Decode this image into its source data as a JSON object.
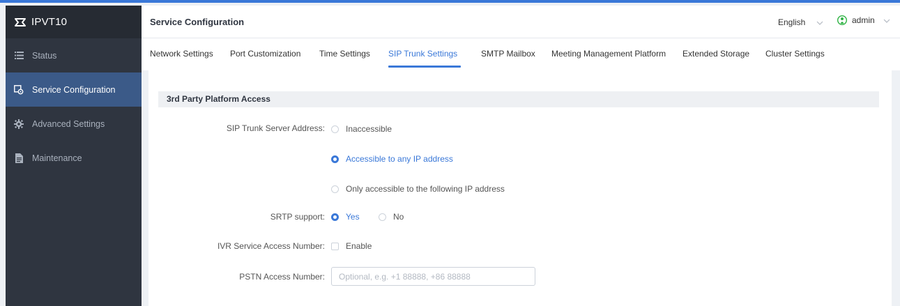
{
  "app": {
    "name": "IPVT10"
  },
  "sidebar": {
    "items": [
      {
        "label": "Status",
        "icon": "list-icon"
      },
      {
        "label": "Service Configuration",
        "icon": "service-config-icon",
        "active": true
      },
      {
        "label": "Advanced Settings",
        "icon": "gear-icon"
      },
      {
        "label": "Maintenance",
        "icon": "document-icon"
      }
    ]
  },
  "header": {
    "title": "Service Configuration",
    "language": "English",
    "user": "admin"
  },
  "tabs": [
    {
      "label": "Network Settings"
    },
    {
      "label": "Port Customization"
    },
    {
      "label": "Time Settings"
    },
    {
      "label": "SIP Trunk Settings",
      "active": true
    },
    {
      "label": "SMTP Mailbox"
    },
    {
      "label": "Meeting Management Platform"
    },
    {
      "label": "Extended Storage"
    },
    {
      "label": "Cluster Settings"
    }
  ],
  "section": {
    "title": "3rd Party Platform Access",
    "sip_trunk_server_address": {
      "label": "SIP Trunk Server Address:",
      "options": [
        "Inaccessible",
        "Accessible to any IP address",
        "Only accessible to the following IP address"
      ],
      "selected": "Accessible to any IP address"
    },
    "srtp_support": {
      "label": "SRTP support:",
      "options": [
        "Yes",
        "No"
      ],
      "selected": "Yes"
    },
    "ivr_service_access_number": {
      "label": "IVR Service Access Number:",
      "checkbox_label": "Enable",
      "checked": false
    },
    "pstn_access_number": {
      "label": "PSTN Access Number:",
      "value": "",
      "placeholder": "Optional, e.g. +1 88888, +86 88888"
    }
  },
  "colors": {
    "accent": "#3a78d8",
    "sidebar_bg": "#2f3540",
    "sidebar_active": "#3b5a88",
    "user_icon": "#2fb344"
  }
}
